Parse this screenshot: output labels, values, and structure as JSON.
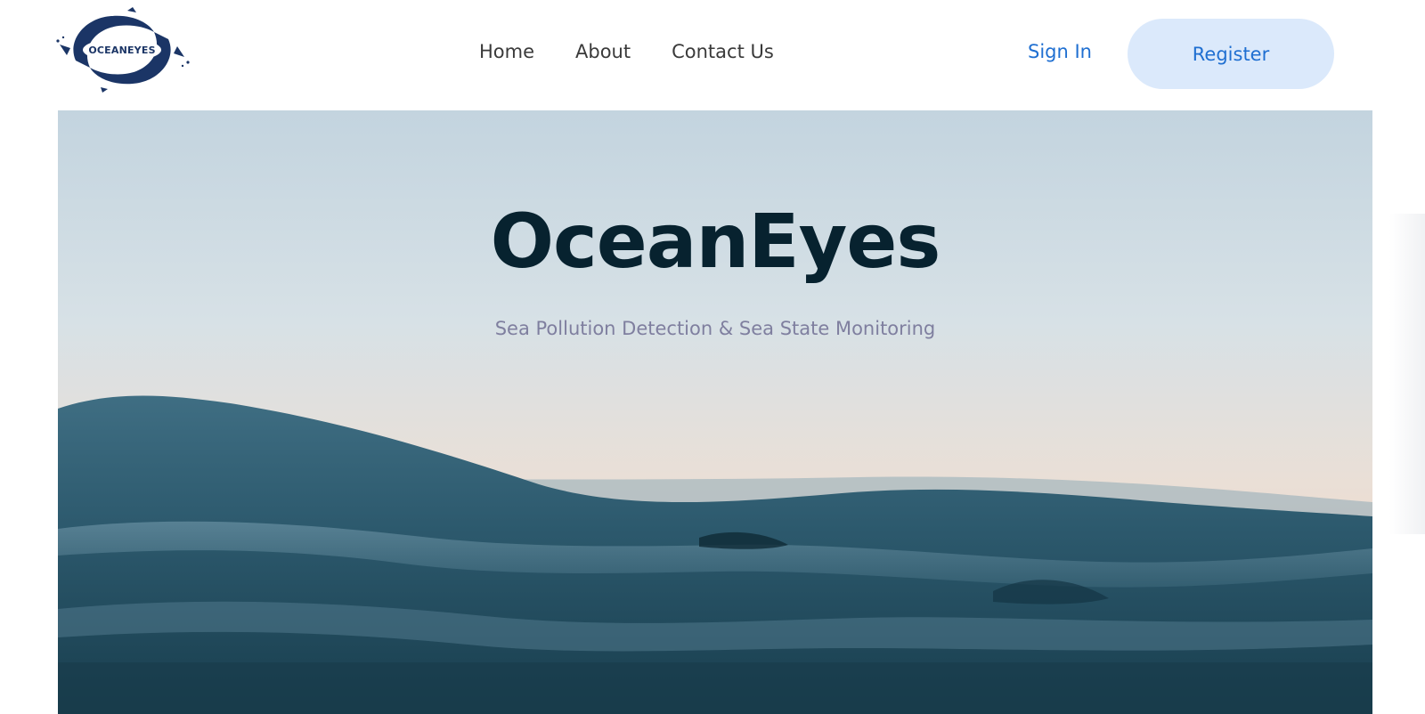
{
  "brand": {
    "logo_text": "OCEANEYES"
  },
  "nav": {
    "links": [
      {
        "label": "Home"
      },
      {
        "label": "About"
      },
      {
        "label": "Contact Us"
      }
    ],
    "sign_in_label": "Sign In",
    "register_label": "Register"
  },
  "hero": {
    "title": "OceanEyes",
    "subtitle": "Sea Pollution Detection & Sea State Monitoring"
  },
  "colors": {
    "accent": "#1f6fd1",
    "register_bg": "#dbe9fb",
    "title": "#07222f",
    "subtitle": "#7f7f9f"
  }
}
